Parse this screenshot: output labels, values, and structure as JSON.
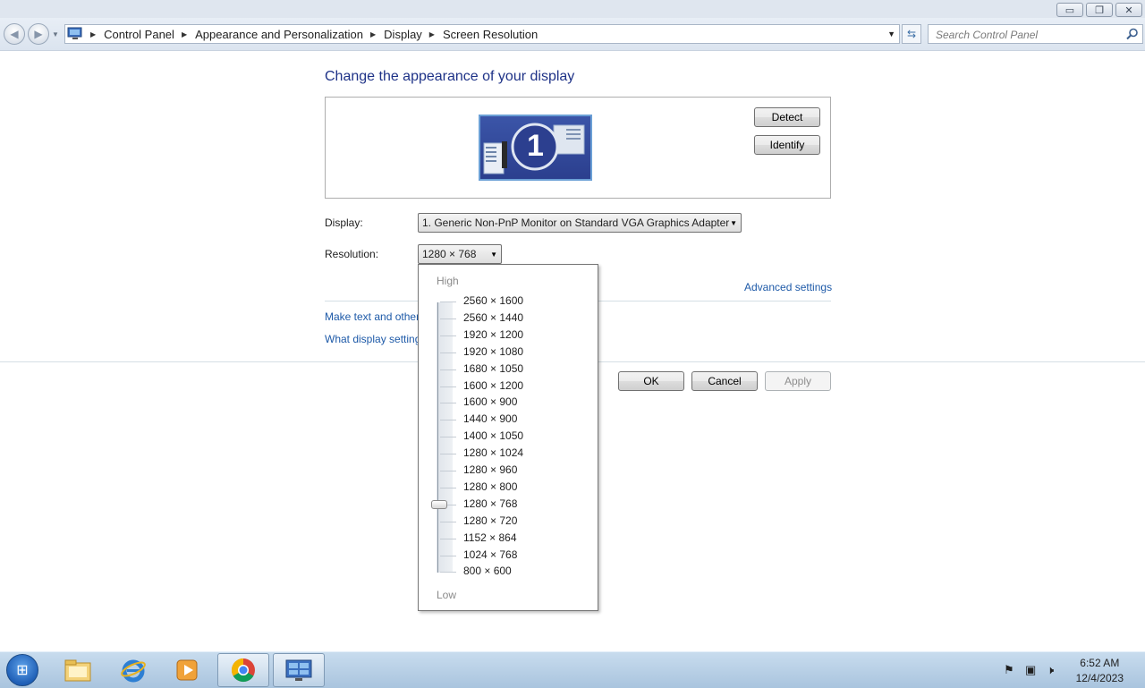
{
  "window": {
    "buttons": {
      "minimize": "▭",
      "restore": "❐",
      "close": "✕"
    }
  },
  "nav": {
    "breadcrumbs": [
      "Control Panel",
      "Appearance and Personalization",
      "Display",
      "Screen Resolution"
    ],
    "search_placeholder": "Search Control Panel"
  },
  "main": {
    "heading": "Change the appearance of your display",
    "monitor_number": "1",
    "detect_label": "Detect",
    "identify_label": "Identify",
    "display_label": "Display:",
    "display_value": "1. Generic Non-PnP Monitor on Standard VGA Graphics Adapter",
    "resolution_label": "Resolution:",
    "resolution_value": "1280 × 768",
    "advanced_link": "Advanced settings",
    "link_text_size": "Make text and other",
    "link_display_settings": "What display setting",
    "ok_label": "OK",
    "cancel_label": "Cancel",
    "apply_label": "Apply"
  },
  "resolution_dropdown": {
    "high_label": "High",
    "low_label": "Low",
    "options": [
      "2560 × 1600",
      "2560 × 1440",
      "1920 × 1200",
      "1920 × 1080",
      "1680 × 1050",
      "1600 × 1200",
      "1600 × 900",
      "1440 × 900",
      "1400 × 1050",
      "1280 × 1024",
      "1280 × 960",
      "1280 × 800",
      "1280 × 768",
      "1280 × 720",
      "1152 × 864",
      "1024 × 768",
      "800 × 600"
    ],
    "selected_index": 12
  },
  "taskbar": {
    "items": [
      "start-orb",
      "file-explorer",
      "internet-explorer",
      "media-player",
      "chrome",
      "control-panel"
    ],
    "time": "6:52 AM",
    "date": "12/4/2023"
  },
  "colors": {
    "heading": "#1e3287",
    "link": "#1e5aa8",
    "taskbar": "#b9d1e8"
  }
}
